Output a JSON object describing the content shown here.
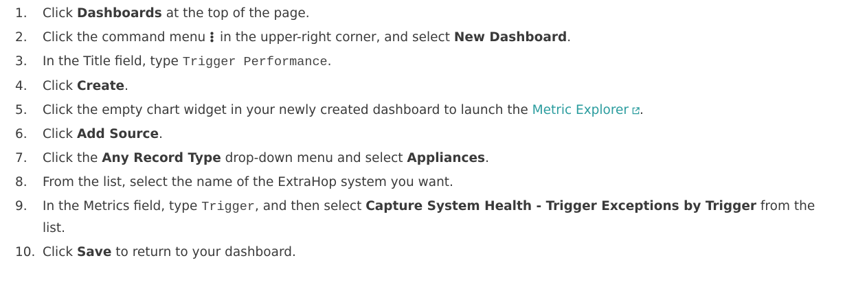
{
  "steps": [
    {
      "num": "1.",
      "pre": "Click ",
      "b1": "Dashboards",
      "post": " at the top of the page."
    },
    {
      "num": "2.",
      "pre": "Click the command menu ",
      "mid": " in the upper-right corner, and select ",
      "b1": "New Dashboard",
      "post": ".",
      "icon": "vertical-dots-icon"
    },
    {
      "num": "3.",
      "pre": "In the Title field, type ",
      "code": "Trigger Performance",
      "post": "."
    },
    {
      "num": "4.",
      "pre": "Click ",
      "b1": "Create",
      "post": "."
    },
    {
      "num": "5.",
      "pre": "Click the empty chart widget in your newly created dashboard to launch the ",
      "link": "Metric Explorer",
      "post": ".",
      "icon": "external-link-icon"
    },
    {
      "num": "6.",
      "pre": "Click ",
      "b1": "Add Source",
      "post": "."
    },
    {
      "num": "7.",
      "pre": "Click the ",
      "b1": "Any Record Type",
      "mid": " drop-down menu and select ",
      "b2": "Appliances",
      "post": "."
    },
    {
      "num": "8.",
      "text": "From the list, select the name of the ExtraHop system you want."
    },
    {
      "num": "9.",
      "pre": "In the Metrics field, type ",
      "code": "Trigger",
      "mid": ", and then select ",
      "b1": "Capture System Health - Trigger Exceptions by Trigger",
      "post": " from the list."
    },
    {
      "num": "10.",
      "pre": "Click ",
      "b1": "Save",
      "post": " to return to your dashboard."
    }
  ],
  "colors": {
    "text": "#3a3a3a",
    "link": "#2a9c9e"
  }
}
